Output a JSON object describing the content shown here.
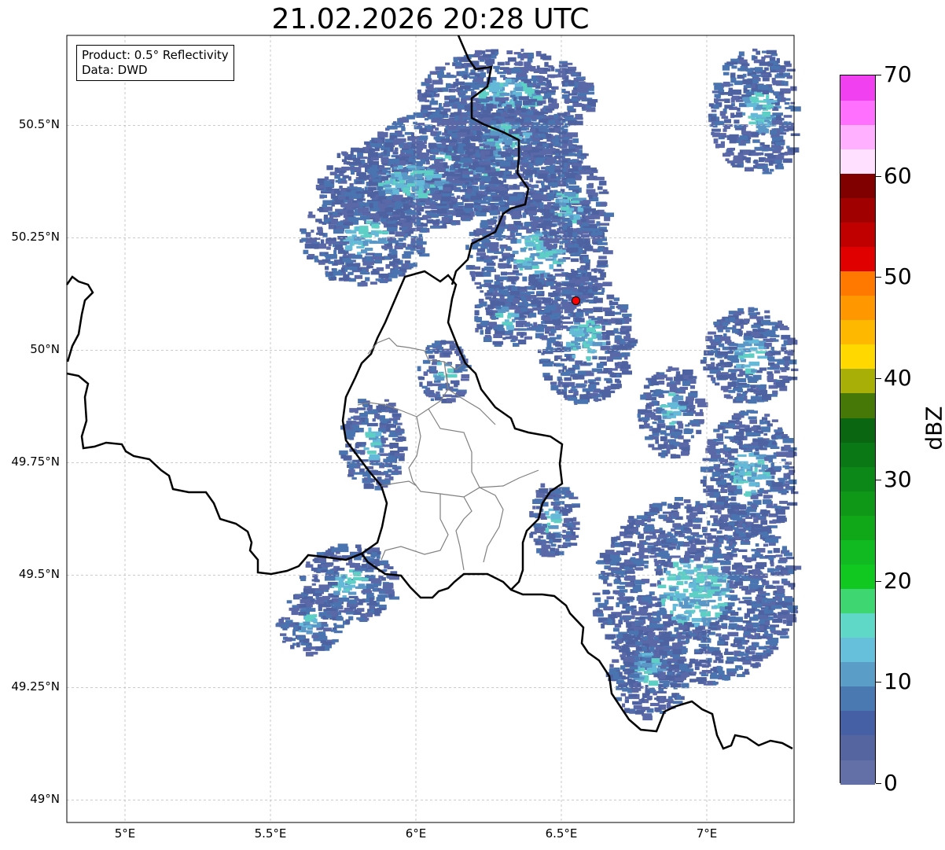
{
  "title": "21.02.2026 20:28 UTC",
  "legend_box": {
    "product": "Product: 0.5° Reflectivity",
    "data": "Data: DWD"
  },
  "lat_ticks": [
    {
      "label": "50.5°N",
      "value": 50.5
    },
    {
      "label": "50.25°N",
      "value": 50.25
    },
    {
      "label": "50°N",
      "value": 50.0
    },
    {
      "label": "49.75°N",
      "value": 49.75
    },
    {
      "label": "49.5°N",
      "value": 49.5
    },
    {
      "label": "49.25°N",
      "value": 49.25
    },
    {
      "label": "49°N",
      "value": 49.0
    }
  ],
  "lon_ticks": [
    {
      "label": "5°E",
      "value": 5.0
    },
    {
      "label": "5.5°E",
      "value": 5.5
    },
    {
      "label": "6°E",
      "value": 6.0
    },
    {
      "label": "6.5°E",
      "value": 6.5
    },
    {
      "label": "7°E",
      "value": 7.0
    }
  ],
  "extent": {
    "lon_min": 4.8,
    "lon_max": 7.3,
    "lat_min": 48.95,
    "lat_max": 50.7
  },
  "radar_site": {
    "lon": 6.55,
    "lat": 50.11,
    "color": "#ff0000"
  },
  "colorbar": {
    "label": "dBZ",
    "min": 0,
    "max": 70,
    "ticks": [
      {
        "label": "0",
        "value": 0
      },
      {
        "label": "10",
        "value": 10
      },
      {
        "label": "20",
        "value": 20
      },
      {
        "label": "30",
        "value": 30
      },
      {
        "label": "40",
        "value": 40
      },
      {
        "label": "50",
        "value": 50
      },
      {
        "label": "60",
        "value": 60
      },
      {
        "label": "70",
        "value": 70
      }
    ],
    "colors": [
      "#6370a8",
      "#5565a0",
      "#4560a5",
      "#4a78b0",
      "#5a9ec8",
      "#66c0dc",
      "#60d8c8",
      "#3dd670",
      "#10c820",
      "#10ba20",
      "#10a818",
      "#0f9818",
      "#0c8818",
      "#0a7814",
      "#0a6610",
      "#467808",
      "#a8b008",
      "#ffd800",
      "#ffb800",
      "#ff9800",
      "#ff7800",
      "#e00000",
      "#c00000",
      "#a00000",
      "#800000",
      "#ffe0ff",
      "#ffb0ff",
      "#ff70ff",
      "#f040f0"
    ]
  }
}
